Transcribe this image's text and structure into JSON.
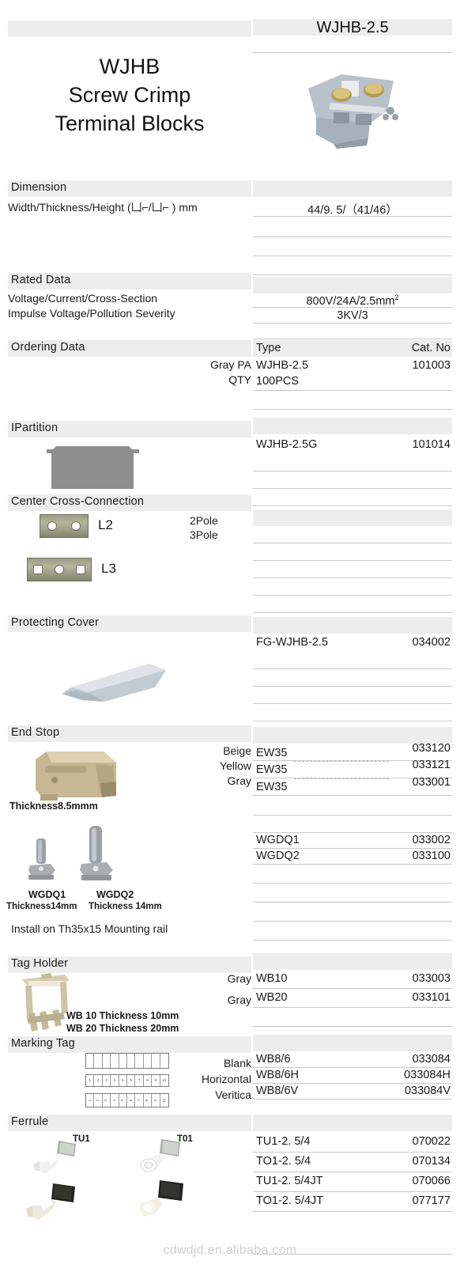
{
  "header": {
    "product_title_lines": [
      "WJHB",
      "Screw Crimp",
      "Terminal Blocks"
    ],
    "product_name": "WJHB-2.5"
  },
  "sections": {
    "dimension": {
      "title": "Dimension",
      "label": "Width/Thickness/Height  (凵⌐/凵⌐ ) mm",
      "value": "44/9. 5/（41/46）"
    },
    "rated_data": {
      "title": "Rated  Data",
      "label_1": "Voltage/Current/Cross-Section",
      "label_2": "Impulse Voltage/Pollution Severity",
      "value_1_prefix": "800V/24A/2.5mm",
      "value_1_sup": "2",
      "value_2": "3KV/3"
    },
    "ordering_data": {
      "title": "Ordering Data",
      "left_labels": [
        "Gray PA",
        "QTY"
      ],
      "col_type": "Type",
      "col_cat": "Cat. No",
      "rows": [
        {
          "type": "WJHB-2.5",
          "cat": "101003"
        },
        {
          "type": "100PCS",
          "cat": ""
        }
      ]
    },
    "partition": {
      "title": "IPartition",
      "rows": [
        {
          "type": "WJHB-2.5G",
          "cat": "101014"
        }
      ]
    },
    "center_cross_connection": {
      "title": "Center Cross-Connection",
      "item_l2": "L2",
      "item_l3": "L3",
      "pole_2": "2Pole",
      "pole_3": "3Pole"
    },
    "protecting_cover": {
      "title": "Protecting Cover",
      "rows": [
        {
          "type": "FG-WJHB-2.5",
          "cat": "034002"
        }
      ]
    },
    "end_stop": {
      "title": "End Stop",
      "colors": [
        "Beige",
        "Yellow",
        "Gray"
      ],
      "thickness_note": "Thickness8.5mmm",
      "rows": [
        {
          "type": "EW35",
          "cat": "033120"
        },
        {
          "type": "EW35",
          "cat": "033121"
        },
        {
          "type": "EW35",
          "cat": "033001"
        }
      ],
      "wgdq_rows": [
        {
          "type": "WGDQ1",
          "cat": "033002"
        },
        {
          "type": "WGDQ2",
          "cat": "033100"
        }
      ],
      "wgdq1_label": "WGDQ1",
      "wgdq2_label": "WGDQ2",
      "wgdq1_thickness": "Thickness14mm",
      "wgdq2_thickness": "Thickness 14mm",
      "install_note": "Install on Th35x15 Mounting rail"
    },
    "tag_holder": {
      "title": "Tag Holder",
      "colors": [
        "Gray",
        "Gray"
      ],
      "note_1": "WB 10 Thickness 10mm",
      "note_2": "WB 20 Thickness 20mm",
      "rows": [
        {
          "type": "WB10",
          "cat": "033003"
        },
        {
          "type": "WB20",
          "cat": "033101"
        }
      ]
    },
    "marking_tag": {
      "title": "Marking Tag",
      "variants": [
        "Blank",
        "Horizontal",
        "Veritica"
      ],
      "strip_numbers": [
        "1",
        "2",
        "3",
        "4",
        "5",
        "6",
        "7",
        "8",
        "9",
        "10"
      ],
      "rows": [
        {
          "type": "WB8/6",
          "cat": "033084"
        },
        {
          "type": "WB8/6H",
          "cat": "033084H"
        },
        {
          "type": "WB8/6V",
          "cat": "033084V"
        }
      ]
    },
    "ferrule": {
      "title": "Ferrule",
      "label_tu1": "TU1",
      "label_to1": "T01",
      "rows": [
        {
          "type": "TU1-2. 5/4",
          "cat": "070022"
        },
        {
          "type": "TO1-2. 5/4",
          "cat": "070134"
        },
        {
          "type": "TU1-2. 5/4JT",
          "cat": "070066"
        },
        {
          "type": "TO1-2. 5/4JT",
          "cat": "077177"
        }
      ]
    }
  },
  "watermark": "cdwdjd.en.alibaba.com",
  "colors": {
    "header_bar": "#ededed",
    "rule": "#c9c9c9",
    "text": "#1a1a1a",
    "watermark": "#cfcfcf"
  }
}
